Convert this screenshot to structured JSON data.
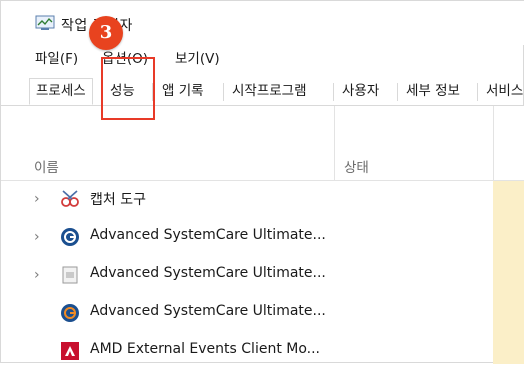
{
  "window": {
    "title": "작업 관리자"
  },
  "menu": {
    "file": "파일(F)",
    "options": "옵션(O)",
    "view": "보기(V)"
  },
  "tabs": [
    {
      "label": "프로세스",
      "active": true
    },
    {
      "label": "성능",
      "active": false
    },
    {
      "label": "앱 기록",
      "active": false
    },
    {
      "label": "시작프로그램",
      "active": false
    },
    {
      "label": "사용자",
      "active": false
    },
    {
      "label": "세부 정보",
      "active": false
    },
    {
      "label": "서비스",
      "active": false
    }
  ],
  "columns": {
    "name": "이름",
    "status": "상태"
  },
  "processes": [
    {
      "name": "캡처 도구",
      "expandable": true,
      "icon": "snipping-tool-icon"
    },
    {
      "name": "Advanced SystemCare Ultimate...",
      "expandable": true,
      "icon": "advanced-systemcare-icon"
    },
    {
      "name": "Advanced SystemCare Ultimate...",
      "expandable": true,
      "icon": "generic-app-icon"
    },
    {
      "name": "Advanced SystemCare Ultimate...",
      "expandable": false,
      "icon": "advanced-systemcare-icon"
    },
    {
      "name": "AMD External Events Client Mo...",
      "expandable": false,
      "icon": "amd-icon"
    }
  ],
  "annotation": {
    "step": "3",
    "color": "#e8431f"
  },
  "colors": {
    "highlight_column": "#fbefc8",
    "annotation_box": "#e83a28"
  }
}
